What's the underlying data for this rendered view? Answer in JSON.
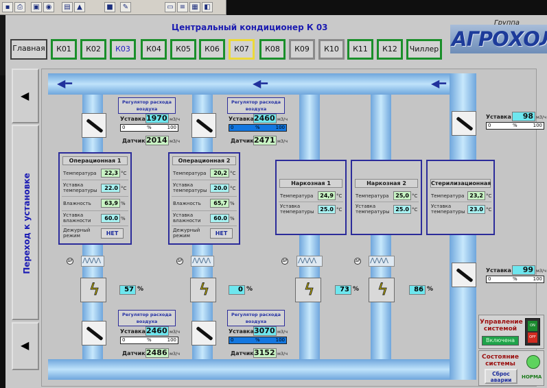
{
  "header": {
    "title": "Центральный кондиционер К 03",
    "group": "Группа компаний",
    "logo_text": "АГРОХОЛОД"
  },
  "toolbar_icons": [
    "save-icon",
    "print-icon",
    "preview-icon",
    "camera-icon",
    "chart-icon",
    "alarm-icon",
    "stop-icon",
    "edit-icon",
    "window-icon",
    "list-icon"
  ],
  "nav": {
    "items": [
      "Главная",
      "К01",
      "К02",
      "К03",
      "К04",
      "К05",
      "К06",
      "К07",
      "К08",
      "К09",
      "К10",
      "К11",
      "К12",
      "Чиллер"
    ],
    "active": "К03"
  },
  "sidebar": {
    "vertical_label": "Переход к установке"
  },
  "regulators": [
    {
      "title": "Регулятор расхода воздуха",
      "setpoint_label": "Уставка",
      "setpoint": "1970",
      "unit": "м3/ч",
      "bar_min": "0",
      "bar_mid": "%",
      "bar_max": "100",
      "bar_fill": 0,
      "sensor_label": "Датчик",
      "sensor": "2014"
    },
    {
      "title": "Регулятор расхода воздуха",
      "setpoint_label": "Уставка",
      "setpoint": "2460",
      "unit": "м3/ч",
      "bar_min": "0",
      "bar_mid": "%",
      "bar_max": "100",
      "bar_fill": 1.0,
      "sensor_label": "Датчик",
      "sensor": "2471"
    },
    {
      "title": "Регулятор расхода воздуха",
      "setpoint_label": "Уставка",
      "setpoint": "2460",
      "unit": "м3/ч",
      "bar_min": "0",
      "bar_mid": "%",
      "bar_max": "100",
      "bar_fill": 0,
      "sensor_label": "Датчик",
      "sensor": "2486"
    },
    {
      "title": "Регулятор расхода воздуха",
      "setpoint_label": "Уставка",
      "setpoint": "3070",
      "unit": "м3/ч",
      "bar_min": "0",
      "bar_mid": "%",
      "bar_max": "100",
      "bar_fill": 1.0,
      "sensor_label": "Датчик",
      "sensor": "3152"
    }
  ],
  "right_setpoints": [
    {
      "label": "Уставка",
      "value": "98",
      "unit": "м3/ч",
      "bar_min": "0",
      "bar_mid": "%",
      "bar_max": "100",
      "bar_fill": 0
    },
    {
      "label": "Уставка",
      "value": "99",
      "unit": "м3/ч",
      "bar_min": "0",
      "bar_mid": "%",
      "bar_max": "100",
      "bar_fill": 0
    }
  ],
  "rooms": {
    "op1": {
      "title": "Операционная 1",
      "temp_label": "Температура",
      "temp": "22,3",
      "temp_unit": "°C",
      "tset_label": "Уставка температуры",
      "tset": "22.0",
      "tset_unit": "°C",
      "hum_label": "Влажность",
      "hum": "63,9",
      "hum_unit": "%",
      "hset_label": "Уставка влажности",
      "hset": "60.0",
      "hset_unit": "%",
      "duty_label": "Дежурный режим",
      "duty": "НЕТ"
    },
    "op2": {
      "title": "Операционная 2",
      "temp_label": "Температура",
      "temp": "20,2",
      "temp_unit": "°C",
      "tset_label": "Уставка температуры",
      "tset": "20.0",
      "tset_unit": "°C",
      "hum_label": "Влажность",
      "hum": "65,7",
      "hum_unit": "%",
      "hset_label": "Уставка влажности",
      "hset": "60.0",
      "hset_unit": "%",
      "duty_label": "Дежурный режим",
      "duty": "НЕТ"
    },
    "n1": {
      "title": "Наркозная 1",
      "temp_label": "Температура",
      "temp": "24,9",
      "temp_unit": "°C",
      "tset_label": "Уставка температуры",
      "tset": "25.0",
      "tset_unit": "°C"
    },
    "n2": {
      "title": "Наркозная 2",
      "temp_label": "Температура",
      "temp": "25,0",
      "temp_unit": "°C",
      "tset_label": "Уставка температуры",
      "tset": "25.0",
      "tset_unit": "°C"
    },
    "st": {
      "title": "Стерилизационная",
      "temp_label": "Температура",
      "temp": "23,2",
      "temp_unit": "°C",
      "tset_label": "Уставка температуры",
      "tset": "23.0",
      "tset_unit": "°C"
    }
  },
  "fans": [
    {
      "value": "57",
      "unit": "%"
    },
    {
      "value": "0",
      "unit": "%"
    },
    {
      "value": "73",
      "unit": "%"
    },
    {
      "value": "86",
      "unit": "%"
    }
  ],
  "control": {
    "title": "Управление системой",
    "on_label": "ON",
    "off_label": "OFF",
    "status": "Включена",
    "state_title": "Состояние системы",
    "reset_label": "Сброс аварии",
    "norm_label": "НОРМА"
  },
  "colors": {
    "pipe": "#8cc4ee",
    "accent": "#1b1bb1",
    "green_border": "#1a8f2a",
    "value_bg": "#c8f3c4",
    "cyan": "#6ee6ee"
  }
}
